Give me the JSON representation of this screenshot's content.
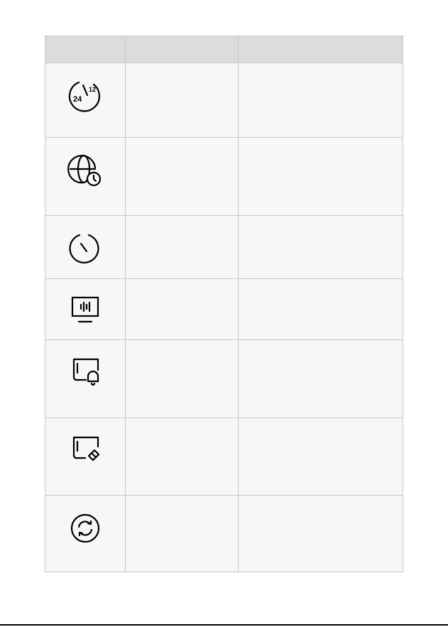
{
  "table": {
    "headers": [
      "",
      "",
      ""
    ],
    "rows": [
      {
        "icon": "clock-24-12-icon",
        "name": "",
        "description": ""
      },
      {
        "icon": "globe-clock-icon",
        "name": "",
        "description": ""
      },
      {
        "icon": "clock-icon",
        "name": "",
        "description": ""
      },
      {
        "icon": "monitor-waveform-icon",
        "name": "",
        "description": ""
      },
      {
        "icon": "sd-card-bell-icon",
        "name": "",
        "description": ""
      },
      {
        "icon": "sd-card-eraser-icon",
        "name": "",
        "description": ""
      },
      {
        "icon": "sync-refresh-icon",
        "name": "",
        "description": ""
      }
    ]
  }
}
